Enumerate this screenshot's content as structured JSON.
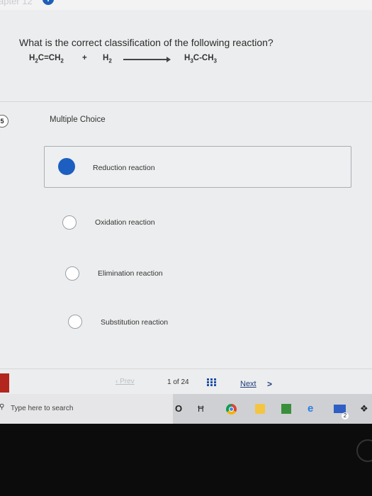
{
  "header": {
    "chapter_fragment": "apter 12",
    "info_icon": "info-circle-icon"
  },
  "question": {
    "number": "5",
    "text": "What is the correct classification of the following reaction?",
    "equation": {
      "reactant1": {
        "a": "H",
        "a_sub": "2",
        "b": "C=CH",
        "b_sub": "2"
      },
      "plus": "+",
      "reactant2": {
        "a": "H",
        "a_sub": "2"
      },
      "product": {
        "a": "H",
        "a_sub": "3",
        "b": "C-CH",
        "b_sub": "3"
      }
    }
  },
  "answer_type": "Multiple Choice",
  "options": [
    {
      "label": "Reduction reaction",
      "selected": true
    },
    {
      "label": "Oxidation reaction",
      "selected": false
    },
    {
      "label": "Elimination reaction",
      "selected": false
    },
    {
      "label": "Substitution reaction",
      "selected": false
    }
  ],
  "navigation": {
    "prev": "Prev",
    "page_current": "1",
    "page_sep": "of",
    "page_total": "24",
    "next": "Next",
    "next_chevron": ">"
  },
  "taskbar": {
    "search_placeholder": "Type here to search",
    "cortana": "O",
    "task_view": "Ħ",
    "edge_glyph": "e",
    "mail_badge": "2",
    "extra_glyph": "❖"
  },
  "colors": {
    "accent": "#1d5fc0",
    "link": "#1f3d7a"
  }
}
